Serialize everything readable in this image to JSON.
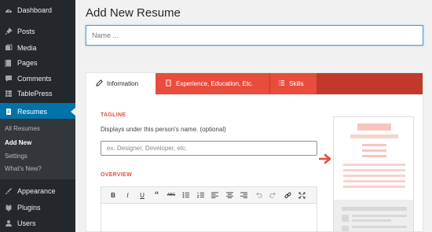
{
  "sidebar": {
    "items": [
      {
        "label": "Dashboard",
        "icon": "dashboard-icon"
      },
      {
        "label": "Posts",
        "icon": "pin-icon"
      },
      {
        "label": "Media",
        "icon": "media-icon"
      },
      {
        "label": "Pages",
        "icon": "pages-icon"
      },
      {
        "label": "Comments",
        "icon": "comment-icon"
      },
      {
        "label": "TablePress",
        "icon": "table-icon"
      },
      {
        "label": "Resumes",
        "icon": "document-icon",
        "active": true
      }
    ],
    "submenu": [
      {
        "label": "All Resumes"
      },
      {
        "label": "Add New",
        "current": true
      },
      {
        "label": "Settings"
      },
      {
        "label": "What's New?"
      }
    ],
    "lower_items": [
      {
        "label": "Appearance",
        "icon": "brush-icon"
      },
      {
        "label": "Plugins",
        "icon": "plugin-icon"
      },
      {
        "label": "Users",
        "icon": "users-icon"
      }
    ]
  },
  "page": {
    "title": "Add New Resume",
    "name_placeholder": "Name ..."
  },
  "tabs": [
    {
      "label": "Information",
      "icon": "pencil-icon",
      "active": true
    },
    {
      "label": "Experience, Education, Etc.",
      "icon": "building-icon"
    },
    {
      "label": "Skills",
      "icon": "list-icon"
    }
  ],
  "tagline": {
    "label": "TAGLINE",
    "description": "Displays under this person's name. (optional)",
    "placeholder": "ex. Designer, Developer, etc."
  },
  "overview": {
    "label": "OVERVIEW",
    "toolbar": [
      "bold",
      "italic",
      "underline",
      "blockquote",
      "strikethrough",
      "bulleted-list",
      "numbered-list",
      "align-left",
      "align-center",
      "align-right",
      "undo",
      "redo",
      "link",
      "fullscreen"
    ]
  },
  "colors": {
    "accent": "#e74c3c",
    "accent_dark": "#c0392b",
    "sidebar_bg": "#23282d",
    "sidebar_active": "#0073aa"
  }
}
